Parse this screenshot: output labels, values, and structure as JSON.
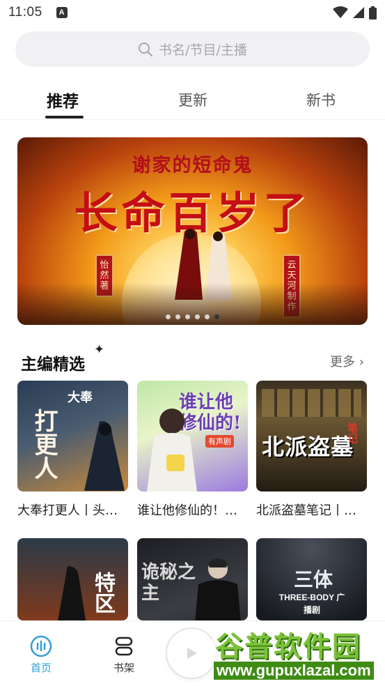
{
  "status_bar": {
    "time": "11:05",
    "notification_icon": "A"
  },
  "search": {
    "placeholder": "书名/节目/主播"
  },
  "tabs": [
    {
      "label": "推荐",
      "active": true
    },
    {
      "label": "更新",
      "active": false
    },
    {
      "label": "新书",
      "active": false
    }
  ],
  "banner": {
    "subtitle": "谢家的短命鬼",
    "title": "长命百岁了",
    "author_tag": "怡然著",
    "producer_tag": "云天河制作",
    "slide_count": 6,
    "active_slide": 6
  },
  "section": {
    "title": "主编精选",
    "more_label": "更多 ›"
  },
  "books": [
    {
      "title": "大奉打更人丨头…",
      "cover_text": "打更人",
      "cover_badge": "大奉"
    },
    {
      "title": "谁让他修仙的！…",
      "cover_text": "谁让他修仙的!",
      "cover_badge": "有声剧"
    },
    {
      "title": "北派盗墓笔记丨…",
      "cover_text": "北派盗墓",
      "cover_badge": "笔记"
    },
    {
      "title": "",
      "cover_text": "特区",
      "cover_badge": ""
    },
    {
      "title": "",
      "cover_text": "诡秘之主",
      "cover_badge": ""
    },
    {
      "title": "",
      "cover_text": "三体",
      "cover_badge": "THREE-BODY 广播剧"
    }
  ],
  "bottom_nav": [
    {
      "label": "首页",
      "icon": "home-icon",
      "active": true
    },
    {
      "label": "书架",
      "icon": "bookshelf-icon",
      "active": false
    }
  ],
  "watermark": {
    "text": "谷普软件园",
    "url": "www.gupuxlazal.com"
  },
  "colors": {
    "accent": "#2f9fd6",
    "banner_red": "#c40e14",
    "highlight": "#a5e6f3"
  }
}
